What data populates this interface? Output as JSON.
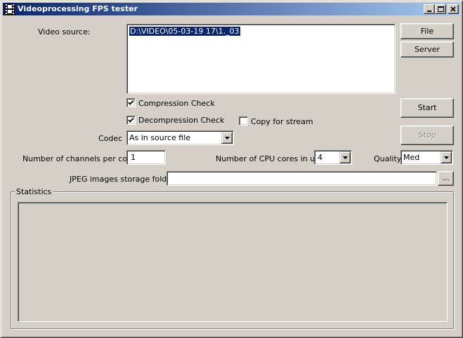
{
  "window": {
    "title": "Videoprocessing FPS tester"
  },
  "titlebar_buttons": {
    "minimize": "_",
    "maximize": "□",
    "close": "×"
  },
  "video_source": {
    "label": "Video source:",
    "value": "D:\\VIDEO\\05-03-19 17\\1._03"
  },
  "buttons": {
    "file": "File",
    "server": "Server",
    "start": "Start",
    "stop": "Stop",
    "browse": "..."
  },
  "checks": {
    "compression": {
      "label": "Compression Check",
      "checked": true
    },
    "decompression": {
      "label": "Decompression Check",
      "checked": true
    },
    "copy_stream": {
      "label": "Copy for stream",
      "checked": false
    }
  },
  "codec": {
    "label": "Codec",
    "value": "As in source file"
  },
  "channels": {
    "label": "Number of channels per core",
    "value": "1"
  },
  "cpu_cores": {
    "label": "Number of CPU cores in use",
    "value": "4"
  },
  "quality": {
    "label": "Quality",
    "value": "Med"
  },
  "jpeg_folder": {
    "label": "JPEG images storage folder",
    "value": ""
  },
  "statistics": {
    "label": "Statistics"
  },
  "icons": {
    "app": "film-strip-icon",
    "check": "checkmark-icon",
    "dropdown": "triangle-down-icon"
  },
  "colors": {
    "face": "#d4d0c8",
    "title_start": "#0a246a",
    "title_end": "#a6caf0",
    "selection": "#0a246a"
  }
}
